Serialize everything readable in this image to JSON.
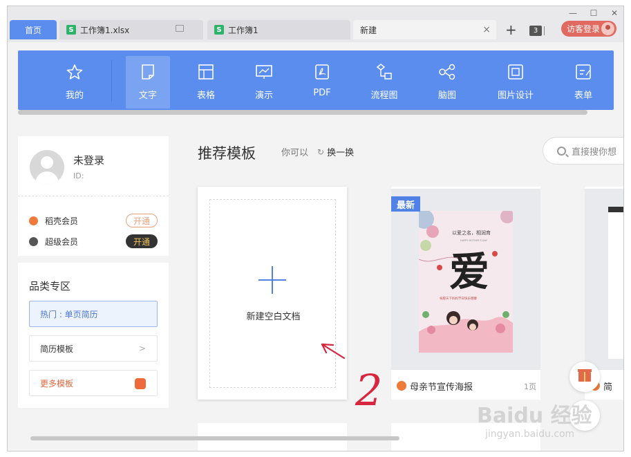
{
  "tabs": {
    "home": "首页",
    "xlsx": "工作簿1.xlsx",
    "book": "工作簿1",
    "new_tab": "新建",
    "xlsx_icon": "S",
    "book_icon": "S",
    "tab_count": "3",
    "login": "访客登录",
    "plus": "+",
    "close": "×"
  },
  "toolbar": {
    "items": [
      {
        "label": "我的",
        "icon": "star-icon"
      },
      {
        "label": "文字",
        "icon": "document-icon"
      },
      {
        "label": "表格",
        "icon": "table-icon"
      },
      {
        "label": "演示",
        "icon": "presentation-icon"
      },
      {
        "label": "PDF",
        "icon": "pdf-icon"
      },
      {
        "label": "流程图",
        "icon": "flowchart-icon"
      },
      {
        "label": "脑图",
        "icon": "mindmap-icon"
      },
      {
        "label": "图片设计",
        "icon": "image-design-icon"
      },
      {
        "label": "表单",
        "icon": "form-icon"
      }
    ],
    "active": "文字"
  },
  "user": {
    "name": "未登录",
    "id_label": "ID:",
    "members": [
      {
        "label": "稻壳会员",
        "button": "开通",
        "color": "#ef7a3a"
      },
      {
        "label": "超级会员",
        "button": "开通",
        "color": "#555555"
      }
    ]
  },
  "category": {
    "title": "品类专区",
    "hot": "热门 : 单页简历",
    "resume": "简历模板",
    "more": "更多模板"
  },
  "main": {
    "title": "推荐模板",
    "you_can": "你可以",
    "swap": "换一换",
    "search_placeholder": "直接搜你想",
    "blank_label": "新建空白文档",
    "templates": [
      {
        "name": "母亲节宣传海报",
        "pages": "1页",
        "tag": "最新"
      },
      {
        "name": "简"
      }
    ]
  },
  "poster": {
    "line1": "以爱之名，相润育",
    "line2": "HAPPY MOTHER'S DAY",
    "big_char": "爱",
    "line3": "祝愿天下妈妈节日快乐健康"
  },
  "annotation": {
    "number": "2"
  },
  "watermark": {
    "brand": "Baidu 经验",
    "url": "jingyan.baidu.com"
  },
  "colors": {
    "accent": "#5b8def",
    "toolbar_active": "#7aa3f2",
    "login": "#e06a5f",
    "orange": "#ef7a3a",
    "annotation_red": "#d7263d"
  }
}
